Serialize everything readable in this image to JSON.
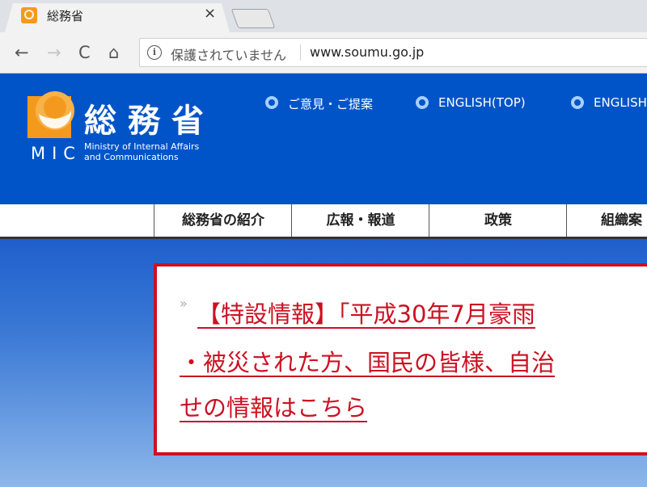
{
  "browser": {
    "tab_title": "総務省",
    "tab_close": "×",
    "back_glyph": "←",
    "forward_glyph": "→",
    "reload_glyph": "C",
    "home_glyph": "⌂",
    "info_glyph": "i",
    "security_label": "保護されていません",
    "url": "www.soumu.go.jp"
  },
  "header": {
    "logo_text": "総務省",
    "logo_abbr": "MIC",
    "logo_en_line1": "Ministry of Internal Affairs",
    "logo_en_line2": "and Communications",
    "links": [
      {
        "label": "ご意見・ご提案"
      },
      {
        "label": "ENGLISH(TOP)"
      },
      {
        "label": "ENGLISH"
      }
    ]
  },
  "global_nav": {
    "items": [
      {
        "label": "総務省の紹介"
      },
      {
        "label": "広報・報道"
      },
      {
        "label": "政策"
      },
      {
        "label": "組織案"
      }
    ]
  },
  "notice": {
    "quote_mark": "»",
    "line1": "【特設情報】「平成30年7月豪雨",
    "line2": "・被災された方、国民の皆様、自治",
    "line3": "せの情報はこちら"
  },
  "colors": {
    "header_blue": "#0054c8",
    "logo_orange": "#f39a1e",
    "notice_red": "#cc1122"
  }
}
